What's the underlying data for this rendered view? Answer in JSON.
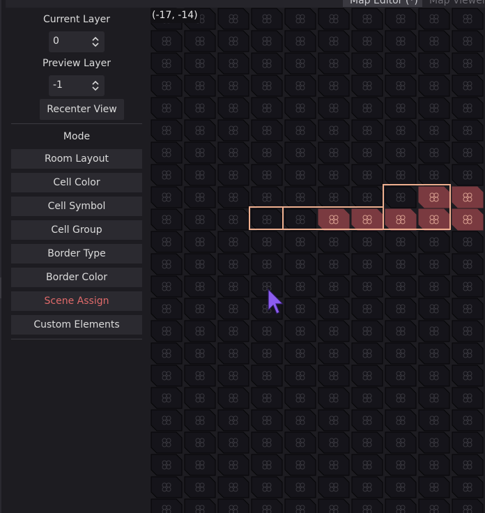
{
  "tabs": {
    "active_label": "Map Editor (*)",
    "inactive_label": "Map Viewer"
  },
  "sidebar": {
    "current_layer_label": "Current Layer",
    "current_layer_value": "0",
    "preview_layer_label": "Preview Layer",
    "preview_layer_value": "-1",
    "recenter_label": "Recenter View",
    "mode_label": "Mode",
    "modes": [
      "Room Layout",
      "Cell Color",
      "Cell Symbol",
      "Cell Group",
      "Border Type",
      "Border Color",
      "Scene Assign",
      "Custom Elements"
    ]
  },
  "map": {
    "coordinate_readout": "(-17, -14)",
    "grid_columns": 10,
    "grid_rows": 23,
    "rooms_note_colors": {
      "cell_fill": "#7a3a40",
      "room_border": "#f0b090",
      "empty_cell": "#15141a",
      "empty_border": "#050506"
    }
  },
  "colors": {
    "panel_bg": "#1d1c21",
    "button_bg": "#2b2a30",
    "accent_red": "#e06a6a",
    "cursor": "#8c5cf0"
  }
}
